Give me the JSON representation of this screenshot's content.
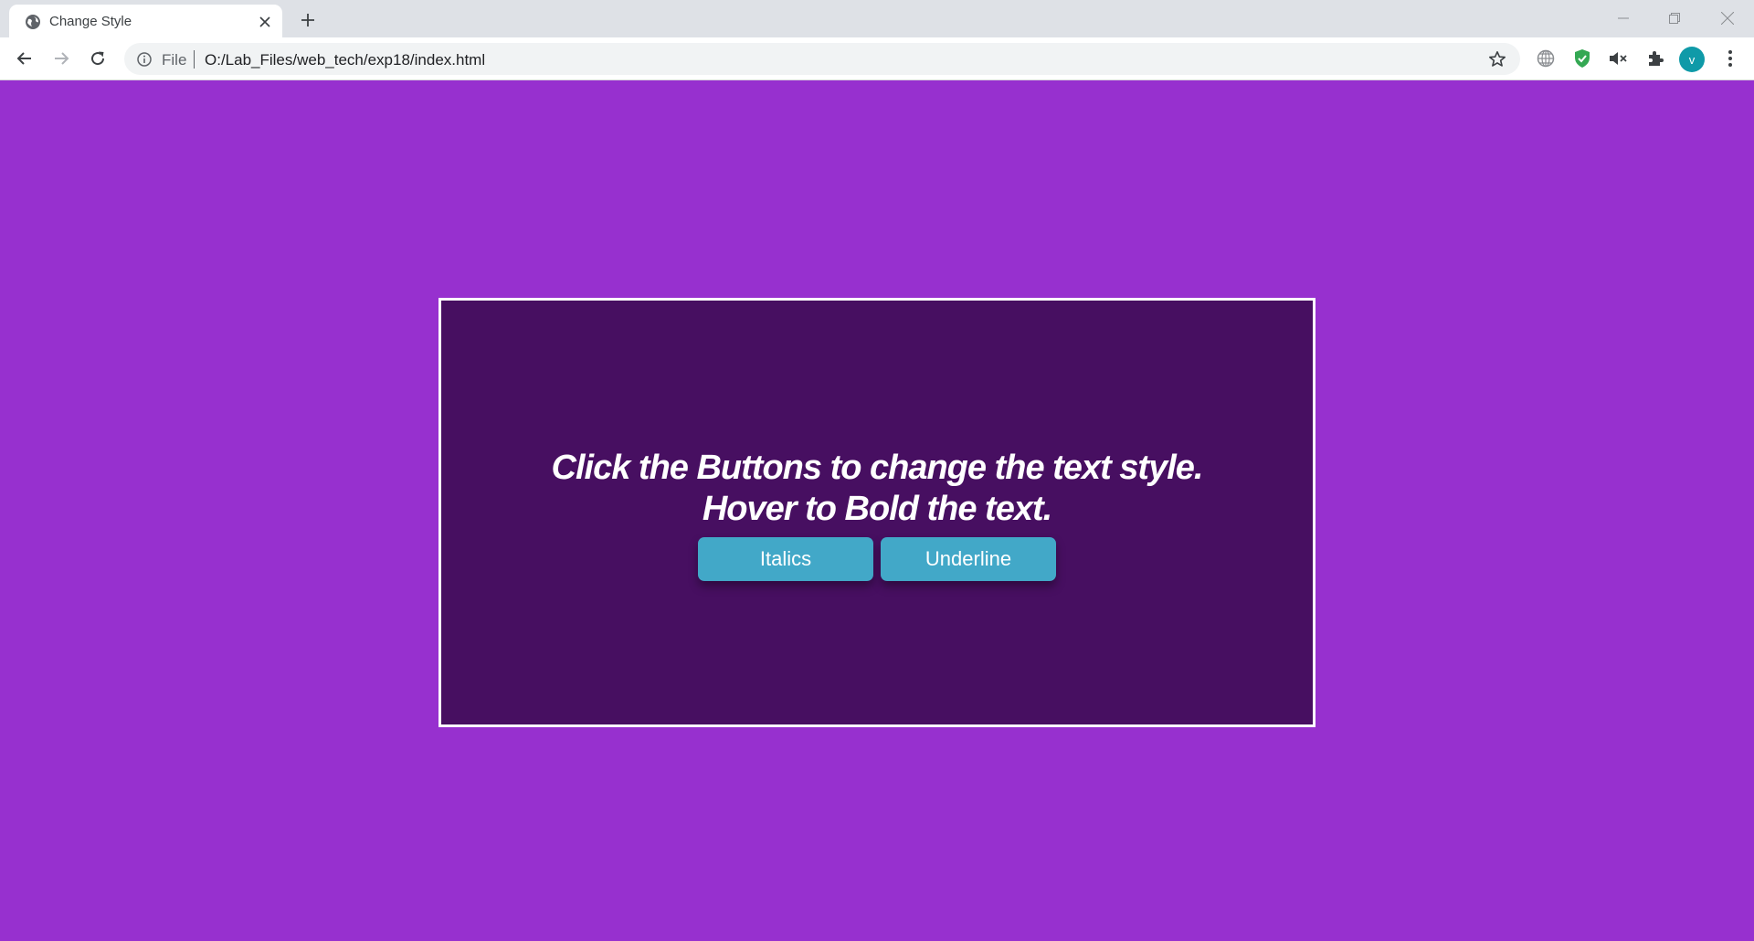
{
  "browser": {
    "tab": {
      "title": "Change Style",
      "favicon": "globe-icon",
      "close_icon": "close-icon"
    },
    "new_tab_icon": "plus-icon",
    "window_controls": [
      "minimize-icon",
      "restore-icon",
      "close-icon"
    ],
    "toolbar": {
      "back_icon": "arrow-left-icon",
      "forward_icon": "arrow-right-icon",
      "reload_icon": "reload-icon",
      "site_info_icon": "info-icon",
      "scheme_label": "File",
      "url": "O:/Lab_Files/web_tech/exp18/index.html",
      "bookmark_icon": "star-icon",
      "extensions": [
        "globe-extension-icon",
        "shield-extension-icon",
        "mute-icon",
        "puzzle-icon"
      ],
      "profile_initial": "v",
      "menu_icon": "kebab-menu-icon"
    }
  },
  "page": {
    "background_color": "#9730cf",
    "card_color": "#470f61",
    "headline_line1": "Click the Buttons to change the text style.",
    "headline_line2": "Hover to Bold the text.",
    "buttons": {
      "italics_label": "Italics",
      "underline_label": "Underline",
      "color": "#42a8c8"
    }
  }
}
